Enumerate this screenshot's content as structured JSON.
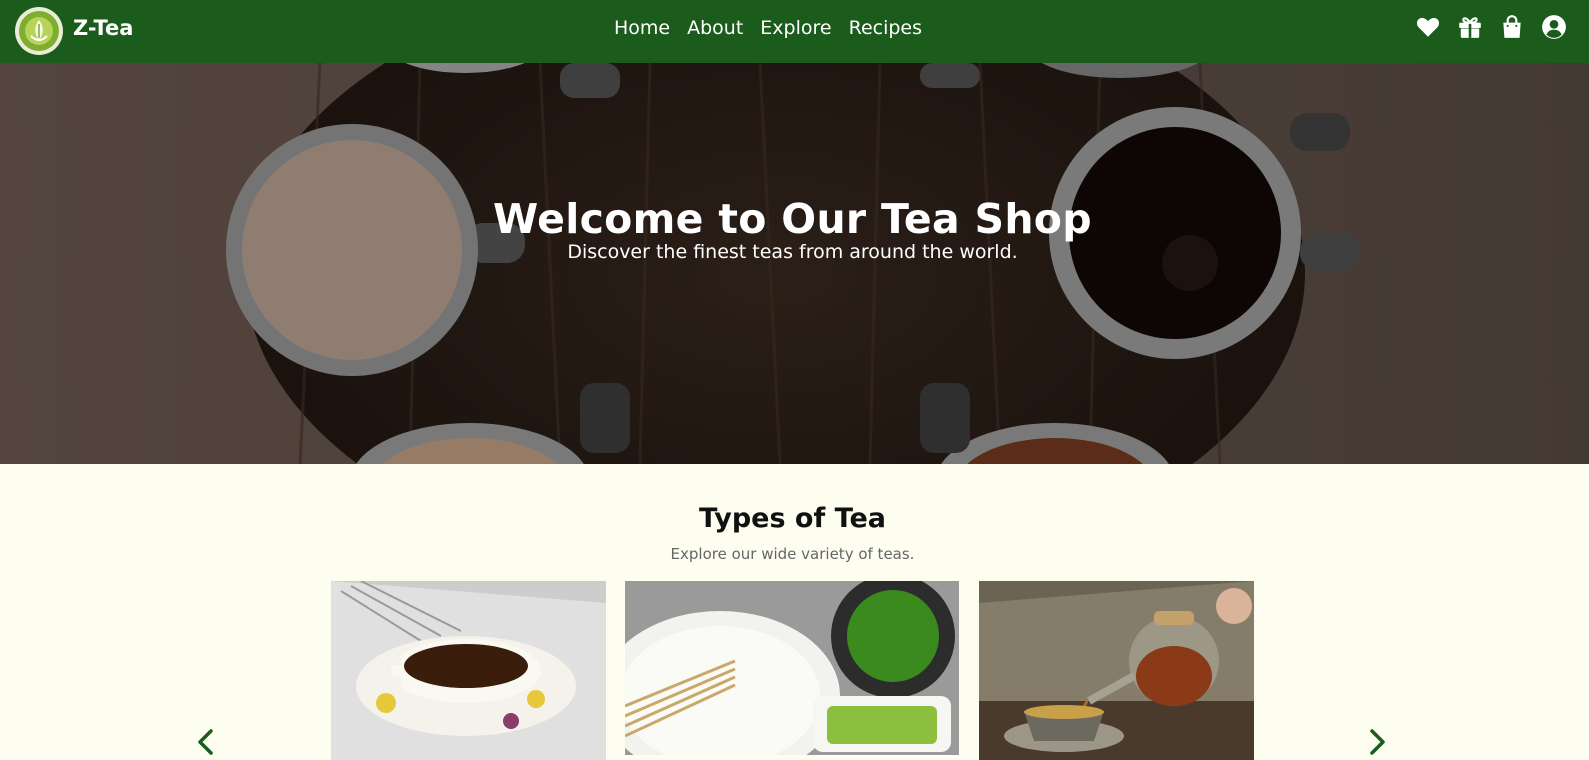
{
  "brand": {
    "name": "Z-Tea",
    "logo_icon": "tea-cup-logo-icon"
  },
  "nav": {
    "links": [
      {
        "label": "Home"
      },
      {
        "label": "About"
      },
      {
        "label": "Explore"
      },
      {
        "label": "Recipes"
      }
    ],
    "icons": [
      "heart-icon",
      "gift-icon",
      "shopping-bag-icon",
      "user-circle-icon"
    ]
  },
  "hero": {
    "title": "Welcome to Our Tea Shop",
    "subtitle": "Discover the finest teas from around the world."
  },
  "types": {
    "title": "Types of Tea",
    "subtitle": "Explore our wide variety of teas.",
    "carousel": {
      "prev_icon": "chevron-left-icon",
      "next_icon": "chevron-right-icon",
      "cards": [
        {
          "image": "black-tea-cup-image"
        },
        {
          "image": "matcha-tea-image"
        },
        {
          "image": "teapot-pouring-image"
        }
      ]
    }
  },
  "colors": {
    "navbar": "#1b5b1b",
    "page_background": "#fefef0",
    "accent": "#1b5b1b",
    "text_light": "#ffffff"
  }
}
